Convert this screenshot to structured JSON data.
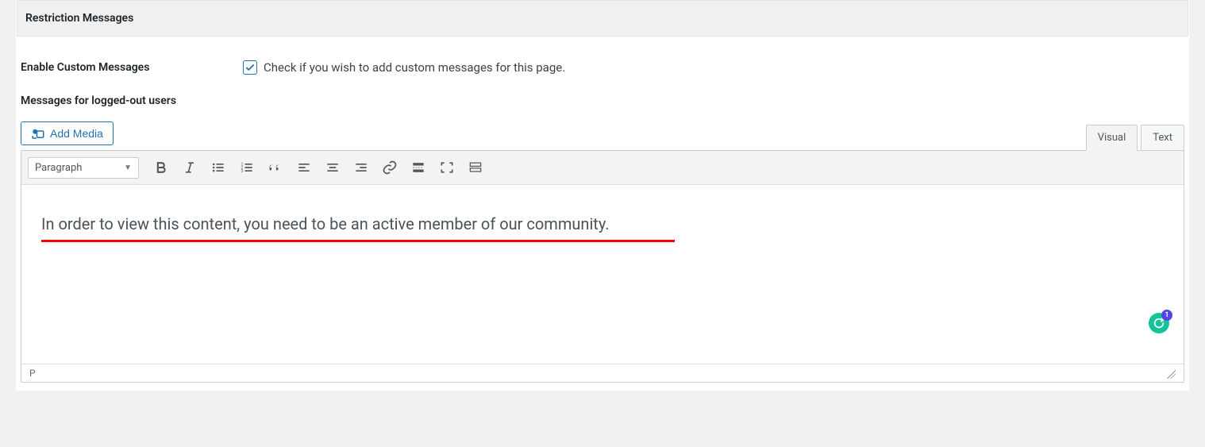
{
  "section": {
    "title": "Restriction Messages"
  },
  "fields": {
    "enable_custom": {
      "label": "Enable Custom Messages",
      "description": "Check if you wish to add custom messages for this page.",
      "checked": true
    },
    "logged_out_label": "Messages for logged-out users"
  },
  "media_button": {
    "label": "Add Media"
  },
  "tabs": {
    "visual": "Visual",
    "text": "Text",
    "active": "visual"
  },
  "toolbar": {
    "format_select": "Paragraph",
    "buttons": [
      "bold",
      "italic",
      "ul",
      "ol",
      "quote",
      "align-left",
      "align-center",
      "align-right",
      "link",
      "more",
      "fullscreen",
      "toolbar-toggle"
    ]
  },
  "editor": {
    "content": "In order to view this content, you need to be an active member of our community.",
    "path": "P"
  },
  "grammarly": {
    "count": "1"
  }
}
